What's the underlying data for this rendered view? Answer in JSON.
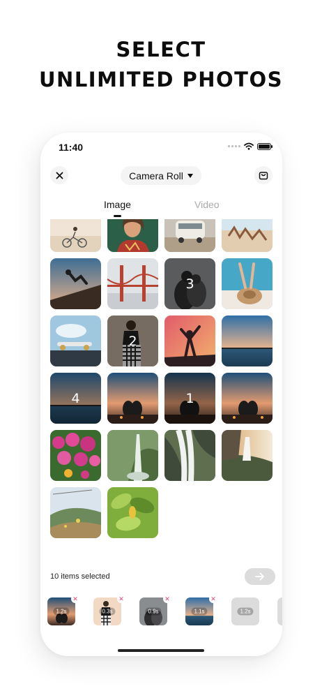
{
  "headline": {
    "line1": "SELECT",
    "line2": "UNLIMITED PHOTOS"
  },
  "status_bar": {
    "time": "11:40"
  },
  "nav": {
    "album_title": "Camera Roll",
    "close_icon": "close-icon",
    "album_icon": "caret-down-icon",
    "bag_icon": "bag-icon"
  },
  "tabs": [
    {
      "label": "Image",
      "active": true
    },
    {
      "label": "Video",
      "active": false
    }
  ],
  "grid": {
    "photos": [
      {
        "subject": "bike-beach",
        "selected": false,
        "order": ""
      },
      {
        "subject": "woman-portrait",
        "selected": false,
        "order": ""
      },
      {
        "subject": "van-desert",
        "selected": false,
        "order": ""
      },
      {
        "subject": "beach-group",
        "selected": false,
        "order": ""
      },
      {
        "subject": "skateboarder",
        "selected": false,
        "order": ""
      },
      {
        "subject": "golden-gate",
        "selected": false,
        "order": ""
      },
      {
        "subject": "couple-hug",
        "selected": true,
        "order": "3"
      },
      {
        "subject": "pool-hat",
        "selected": false,
        "order": ""
      },
      {
        "subject": "skateboard-sky",
        "selected": false,
        "order": ""
      },
      {
        "subject": "woman-checkered",
        "selected": true,
        "order": "2"
      },
      {
        "subject": "dancer-sunset",
        "selected": false,
        "order": ""
      },
      {
        "subject": "pier-dusk",
        "selected": false,
        "order": ""
      },
      {
        "subject": "pier-dusk-2",
        "selected": true,
        "order": "4"
      },
      {
        "subject": "couple-sunset",
        "selected": false,
        "order": ""
      },
      {
        "subject": "couple-sunset-2",
        "selected": true,
        "order": "1"
      },
      {
        "subject": "couple-sunset-3",
        "selected": false,
        "order": ""
      },
      {
        "subject": "flowers",
        "selected": false,
        "order": ""
      },
      {
        "subject": "waterfall-green",
        "selected": false,
        "order": ""
      },
      {
        "subject": "waterfall-rocks",
        "selected": false,
        "order": ""
      },
      {
        "subject": "waterfall-sunset",
        "selected": false,
        "order": ""
      },
      {
        "subject": "hill-grass",
        "selected": false,
        "order": ""
      },
      {
        "subject": "leaves",
        "selected": false,
        "order": ""
      }
    ]
  },
  "footer": {
    "selected_count": "10 items selected",
    "next_icon": "arrow-right-icon"
  },
  "tray": {
    "items": [
      {
        "subject": "couple-sunset",
        "duration": "1.2s",
        "removable": true
      },
      {
        "subject": "woman-checkered",
        "duration": "0.3s",
        "removable": true
      },
      {
        "subject": "couple-hug",
        "duration": "0.9s",
        "removable": true
      },
      {
        "subject": "pier-dusk",
        "duration": "1.1s",
        "removable": true
      },
      {
        "subject": "empty",
        "duration": "1.2s",
        "removable": false
      },
      {
        "subject": "empty",
        "duration": "",
        "removable": false
      }
    ]
  },
  "colors": {
    "selection_border": "#e8e26a",
    "remove_badge": "#e0457b",
    "accent_text": "#111111",
    "inactive_tab": "#aaaaaa"
  }
}
